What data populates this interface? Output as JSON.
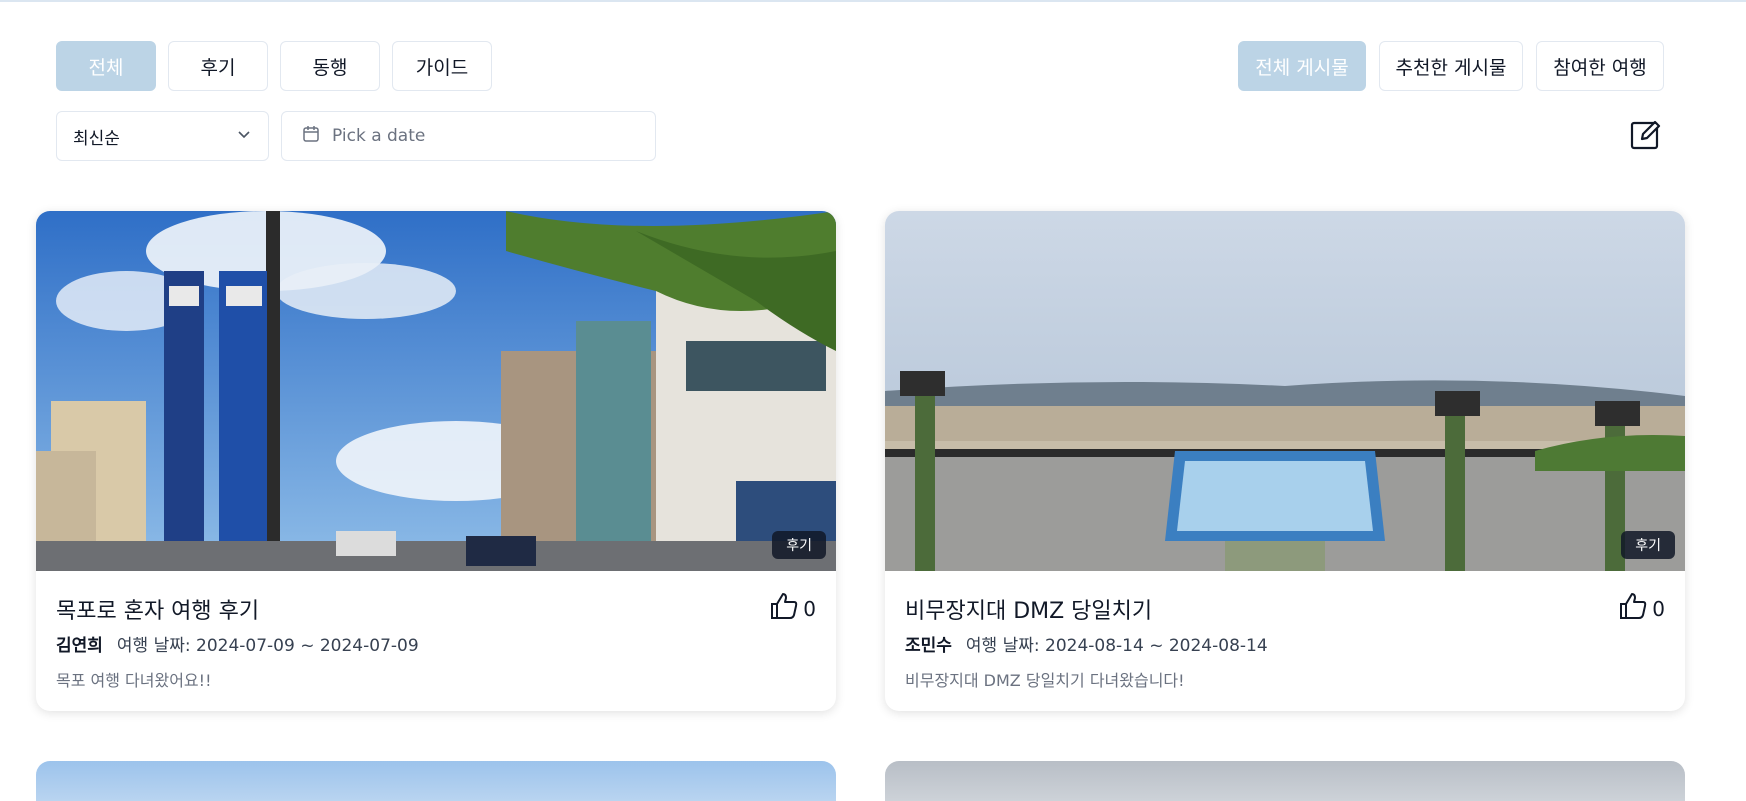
{
  "filters": {
    "category_tabs": [
      "전체",
      "후기",
      "동행",
      "가이드"
    ],
    "view_tabs": [
      "전체 게시물",
      "추천한 게시물",
      "참여한 여행"
    ],
    "sort": {
      "value": "최신순"
    },
    "date": {
      "placeholder": "Pick a date"
    }
  },
  "icons": {
    "chevron": "chevron-down-icon",
    "calendar": "calendar-icon",
    "write": "edit-icon",
    "like": "thumbs-up-icon"
  },
  "colors": {
    "active_tab": "#bcd4e6",
    "badge": "#111827"
  },
  "posts": [
    {
      "title": "목포로 혼자 여행 후기",
      "author": "김연희",
      "dates": "여행 날짜: 2024-07-09 ~ 2024-07-09",
      "excerpt": "목포 여행 다녀왔어요!!",
      "badge": "후기",
      "likes": "0"
    },
    {
      "title": "비무장지대 DMZ 당일치기",
      "author": "조민수",
      "dates": "여행 날짜: 2024-08-14 ~ 2024-08-14",
      "excerpt": "비무장지대 DMZ 당일치기 다녀왔습니다!",
      "badge": "후기",
      "likes": "0"
    }
  ]
}
